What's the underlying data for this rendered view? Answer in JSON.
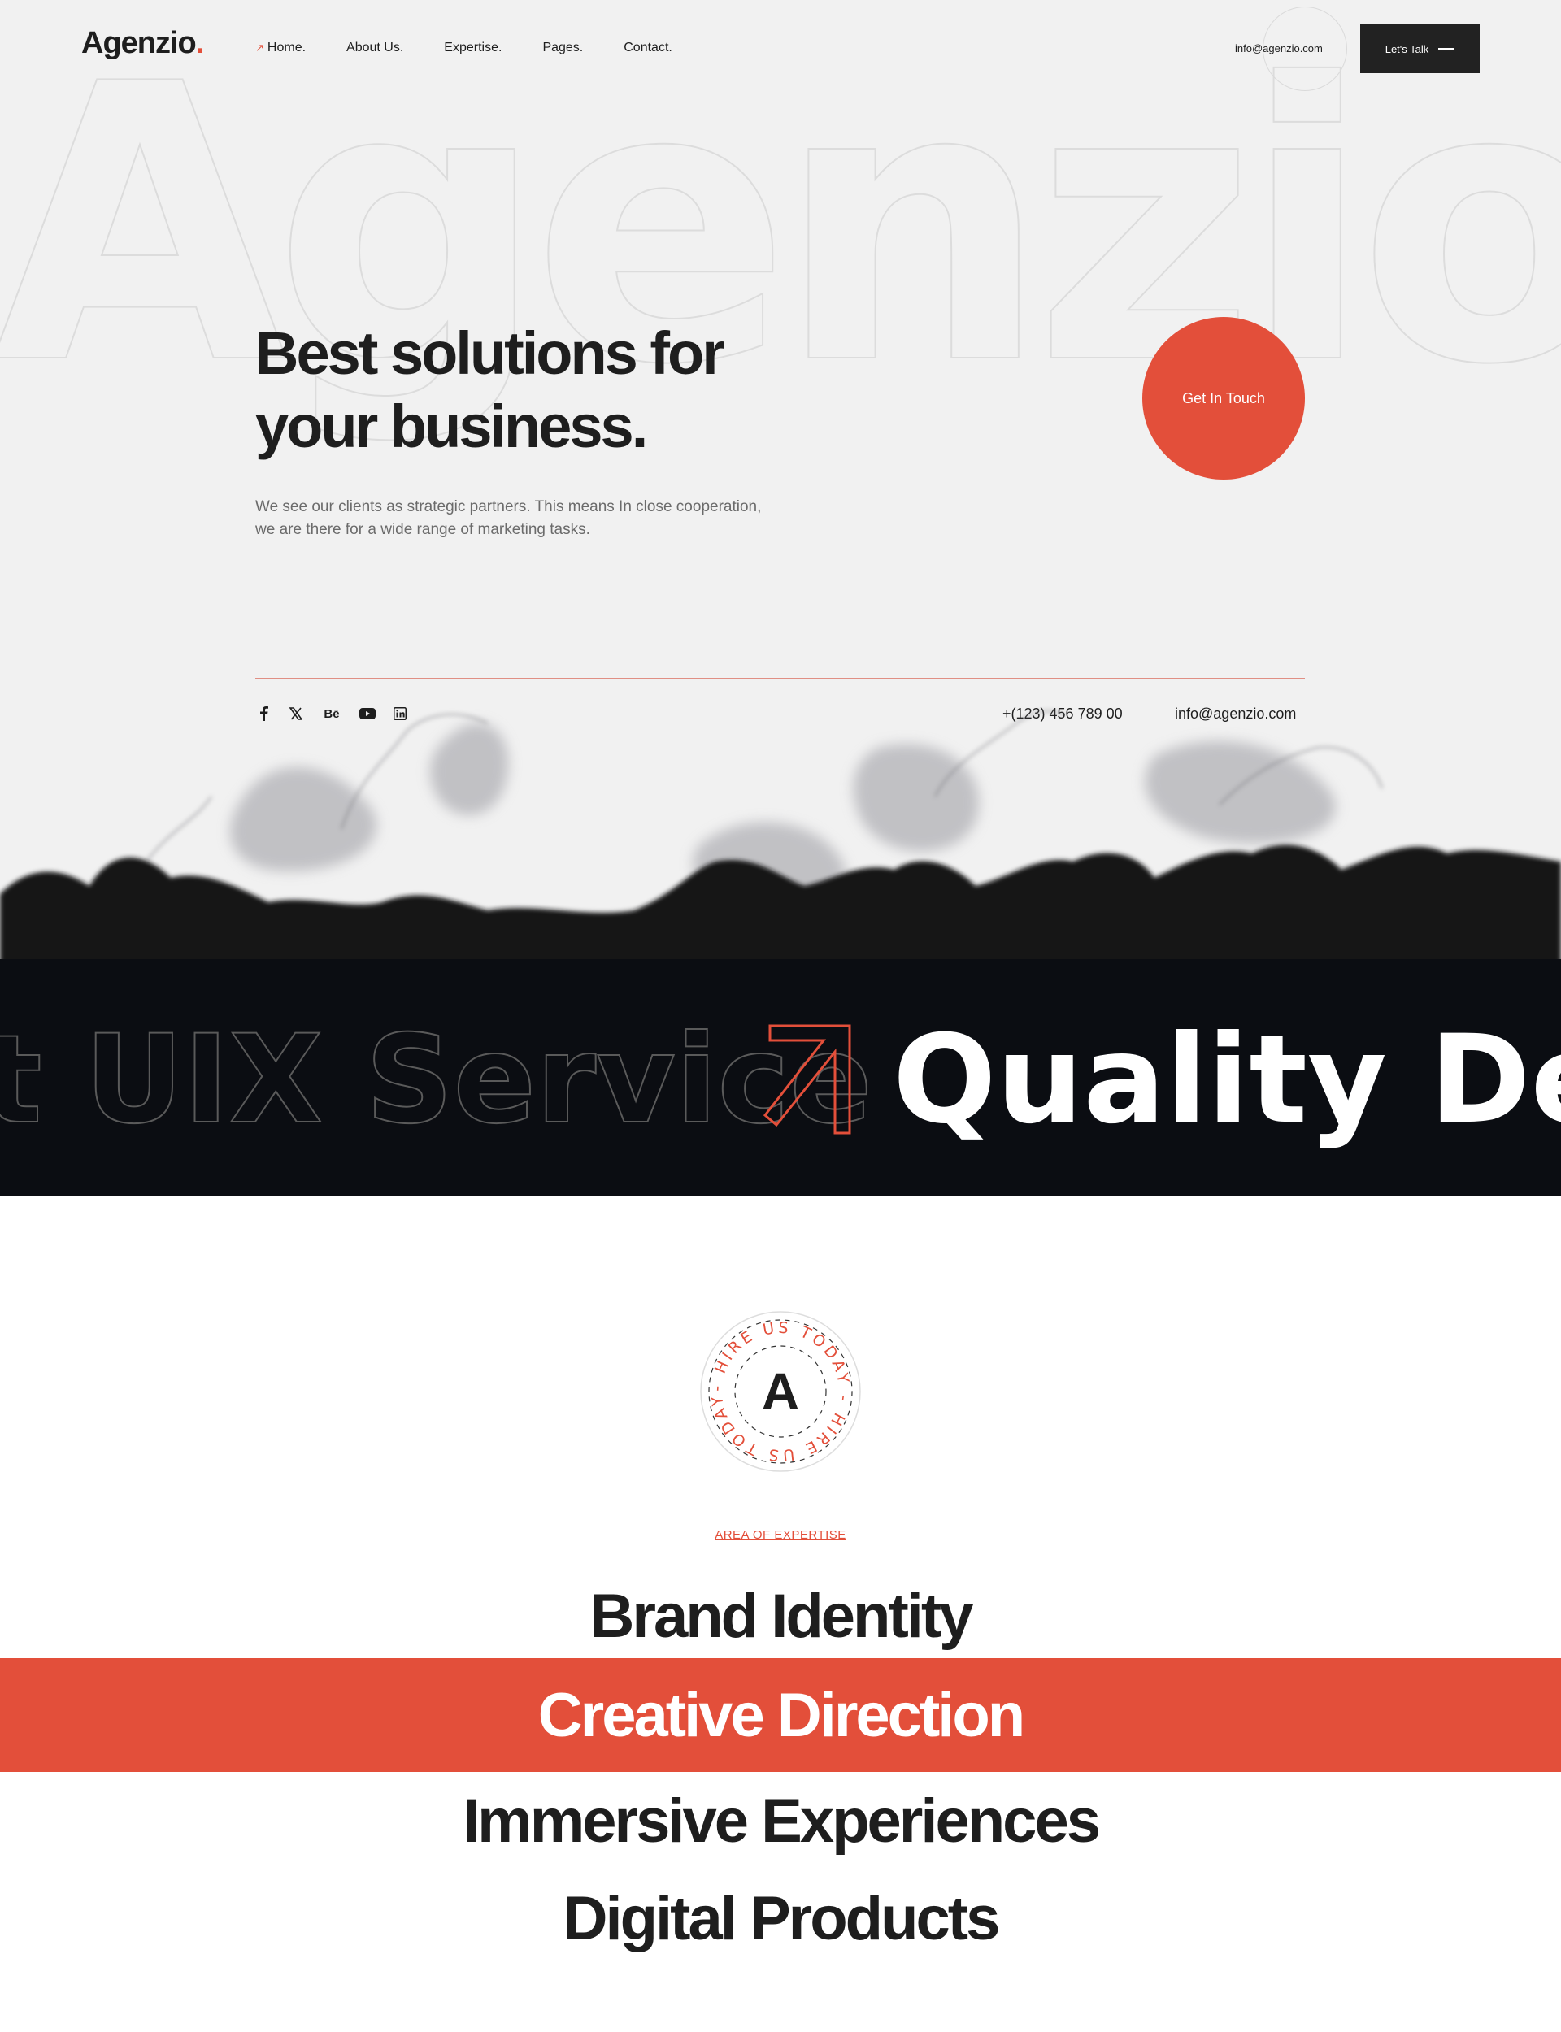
{
  "header": {
    "logo_text": "Agenzio",
    "logo_dot": ".",
    "nav": [
      {
        "label": "Home.",
        "active": true
      },
      {
        "label": "About Us."
      },
      {
        "label": "Expertise."
      },
      {
        "label": "Pages."
      },
      {
        "label": "Contact."
      }
    ],
    "email": "info@agenzio.com",
    "cta_label": "Let's Talk"
  },
  "hero": {
    "background_word": "Agenzio",
    "title_line1": "Best solutions for",
    "title_line2": "your business.",
    "description_line1": "We see our clients as strategic partners. This means In close cooperation,",
    "description_line2": "we are there for a wide range of marketing tasks.",
    "cta_circle": "Get In Touch",
    "socials": [
      "facebook-icon",
      "x-icon",
      "behance-icon",
      "youtube-icon",
      "linkedin-icon"
    ],
    "behance_glyph": "Bē",
    "phone": "+(123) 456 789 00",
    "email": "info@agenzio.com"
  },
  "marquee": {
    "outline_text": "t UIX Service",
    "solid_text": "Quality Des"
  },
  "expertise": {
    "badge_letter": "A",
    "badge_ring_text": "- HIRE US TODAY - HIRE US TODAY",
    "section_label": "AREA OF EXPERTISE",
    "items": [
      {
        "label": "Brand Identity"
      },
      {
        "label": "Creative Direction",
        "active": true
      },
      {
        "label": "Immersive Experiences"
      },
      {
        "label": "Digital Products"
      }
    ]
  },
  "colors": {
    "accent": "#e34f3a",
    "dark": "#0b0d12",
    "hero_bg": "#f1f1f1",
    "button_dark": "#222222"
  }
}
